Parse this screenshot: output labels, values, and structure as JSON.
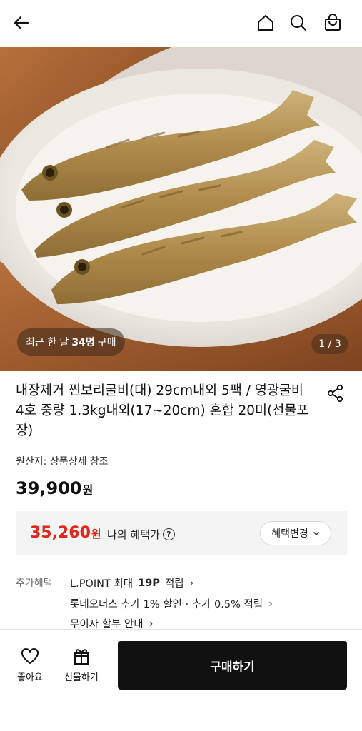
{
  "header": {
    "back_icon": "arrow-left-icon",
    "home_icon": "home-icon",
    "search_icon": "search-icon",
    "cart_icon": "shopping-bag-icon"
  },
  "hero": {
    "recent_prefix": "최근 한 달",
    "recent_count": "34명",
    "recent_suffix": "구매",
    "pager": "1 / 3"
  },
  "product": {
    "title": "내장제거 찐보리굴비(대) 29cm내외 5팩 / 영광굴비 4호 중량 1.3kg내외(17~20cm) 혼합 20미(선물포장)",
    "origin": "원산지: 상품상세 참조",
    "price": "39,900",
    "price_unit": "원"
  },
  "benefit": {
    "price": "35,260",
    "price_unit": "원",
    "label": "나의 혜택가",
    "help_icon": "?",
    "change_button": "혜택변경"
  },
  "extra_benefits": {
    "label": "추가혜택",
    "lpoint_prefix": "L.POINT 최대",
    "lpoint_points": "19P",
    "lpoint_suffix": "적립",
    "card_benefit": "롯데오너스 추가 1% 할인 · 추가 0.5% 적립",
    "installment": "무이자 할부 안내"
  },
  "bottom_bar": {
    "like_label": "좋아요",
    "gift_label": "선물하기",
    "buy_label": "구매하기"
  },
  "colors": {
    "accent_red": "#e3271c",
    "buy_button": "#111111",
    "benefit_bg": "#f4f4f4"
  }
}
